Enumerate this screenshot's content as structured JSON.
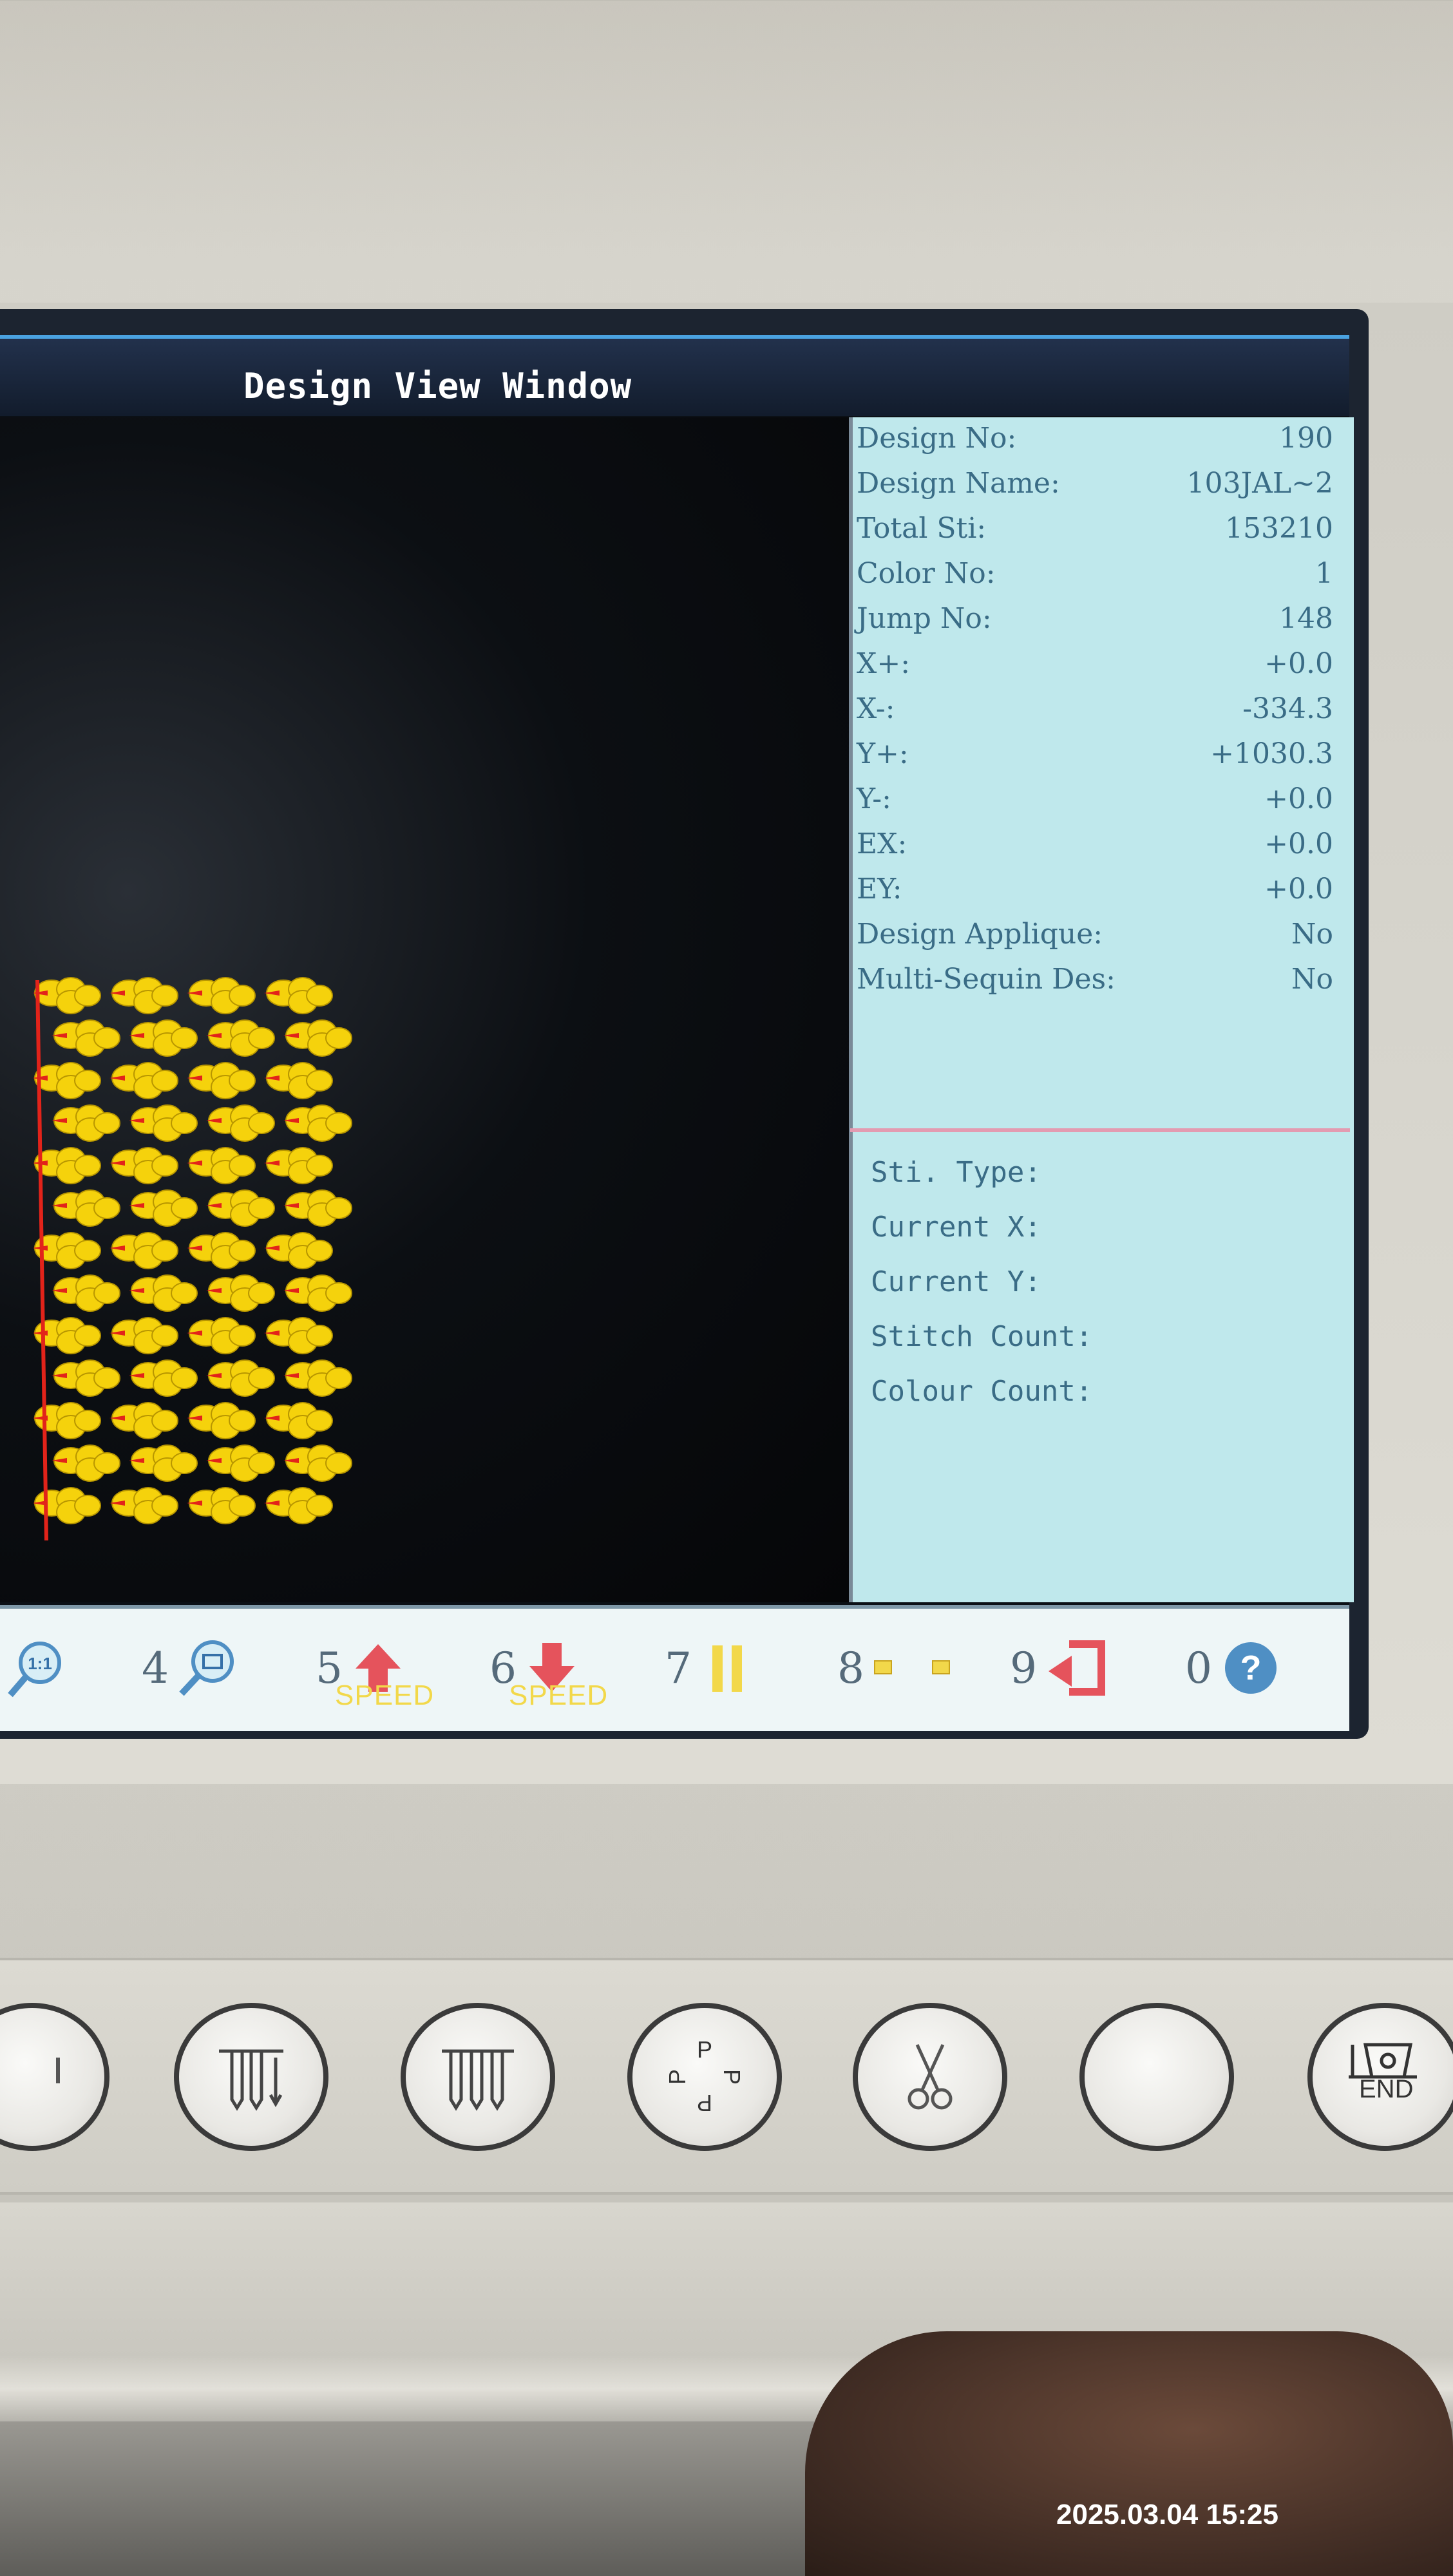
{
  "window": {
    "title": "Design View Window"
  },
  "design_info": [
    {
      "label": "Design No:",
      "value": "190"
    },
    {
      "label": "Design Name:",
      "value": "103JAL~2"
    },
    {
      "label": "Total Sti:",
      "value": "153210"
    },
    {
      "label": "Color No:",
      "value": "1"
    },
    {
      "label": "Jump No:",
      "value": "148"
    },
    {
      "label": "X+:",
      "value": "+0.0"
    },
    {
      "label": "X-:",
      "value": "-334.3"
    },
    {
      "label": "Y+:",
      "value": "+1030.3"
    },
    {
      "label": "Y-:",
      "value": "+0.0"
    },
    {
      "label": "EX:",
      "value": "+0.0"
    },
    {
      "label": "EY:",
      "value": "+0.0"
    },
    {
      "label": "Design Applique:",
      "value": "No"
    },
    {
      "label": "Multi-Sequin Des:",
      "value": "No"
    }
  ],
  "current_info": [
    {
      "label": "Sti. Type:"
    },
    {
      "label": "Current X:"
    },
    {
      "label": "Current Y:"
    },
    {
      "label": "Stitch Count:"
    },
    {
      "label": "Colour Count:"
    }
  ],
  "toolbar": {
    "items": [
      {
        "key": "",
        "name": "zoom-1-1",
        "icon": "zoom-actual-size-icon",
        "badge": "1:1"
      },
      {
        "key": "4",
        "name": "zoom-fit",
        "icon": "zoom-window-icon"
      },
      {
        "key": "5",
        "name": "speed-up",
        "icon": "arrow-up-icon",
        "label": "SPEED"
      },
      {
        "key": "6",
        "name": "speed-down",
        "icon": "arrow-down-icon",
        "label": "SPEED"
      },
      {
        "key": "7",
        "name": "pause",
        "icon": "pause-icon"
      },
      {
        "key": "8",
        "name": "trace",
        "icon": "trace-icon"
      },
      {
        "key": "9",
        "name": "return",
        "icon": "return-icon"
      },
      {
        "key": "0",
        "name": "help",
        "icon": "help-icon"
      }
    ]
  },
  "hardware_keys": [
    {
      "name": "key-left",
      "icon": "unknown-icon"
    },
    {
      "name": "key-needle-left",
      "icon": "needle-left-icon"
    },
    {
      "name": "key-needle-right",
      "icon": "needle-right-icon"
    },
    {
      "name": "key-pp",
      "icon": "pp-rotate-icon",
      "text": "PP"
    },
    {
      "name": "key-trim",
      "icon": "scissors-icon"
    },
    {
      "name": "key-blank",
      "icon": ""
    },
    {
      "name": "key-end",
      "icon": "end-flower-icon",
      "text": "END"
    }
  ],
  "photo_timestamp": "2025.03.04 15:25",
  "colors": {
    "panel_bg": "#bfe8ec",
    "panel_text": "#3a6c86",
    "embroidery_fill": "#f5d20c",
    "embroidery_stitch": "#e2231a",
    "speed_label": "#f2d84a",
    "arrow_red": "#e5535c"
  }
}
